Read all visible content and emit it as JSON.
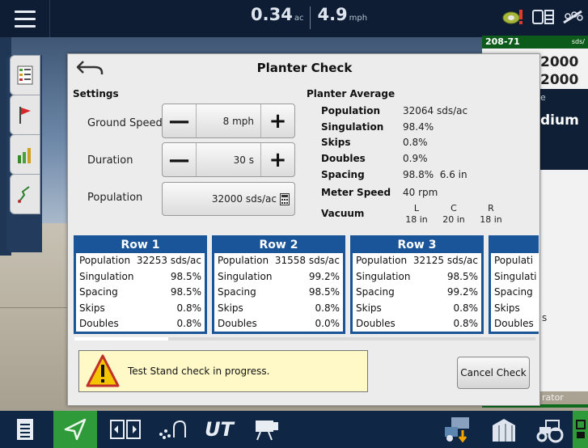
{
  "topbar": {
    "area_value": "0.34",
    "area_unit": "ac",
    "speed_value": "4.9",
    "speed_unit": "mph"
  },
  "right_panel": {
    "header": "208-71",
    "header_small": "sds/",
    "value1": "2000",
    "value2": "2000",
    "label_e": "e",
    "label_dium": "dium",
    "label_s": "s",
    "label_rator": "rator"
  },
  "dialog": {
    "title": "Planter Check",
    "settings": {
      "heading": "Settings",
      "ground_speed_label": "Ground Speed",
      "ground_speed_value": "8 mph",
      "duration_label": "Duration",
      "duration_value": "30 s",
      "population_label": "Population",
      "population_value": "32000 sds/ac"
    },
    "planter_average": {
      "heading": "Planter Average",
      "population_label": "Population",
      "population_value": "32064 sds/ac",
      "singulation_label": "Singulation",
      "singulation_value": "98.4%",
      "skips_label": "Skips",
      "skips_value": "0.8%",
      "doubles_label": "Doubles",
      "doubles_value": "0.9%",
      "spacing_label": "Spacing",
      "spacing_value": "98.8%  6.6 in",
      "meter_speed_label": "Meter Speed",
      "meter_speed_value": "40 rpm",
      "vacuum_label": "Vacuum",
      "vacuum": [
        {
          "side": "L",
          "value": "18 in"
        },
        {
          "side": "C",
          "value": "20 in"
        },
        {
          "side": "R",
          "value": "18 in"
        }
      ]
    },
    "rows": [
      {
        "title": "Row 1",
        "population_label": "Population",
        "population": "32253 sds/ac",
        "singulation_label": "Singulation",
        "singulation": "98.5%",
        "spacing_label": "Spacing",
        "spacing": "98.5%",
        "skips_label": "Skips",
        "skips": "0.8%",
        "doubles_label": "Doubles",
        "doubles": "0.8%"
      },
      {
        "title": "Row 2",
        "population_label": "Population",
        "population": "31558 sds/ac",
        "singulation_label": "Singulation",
        "singulation": "99.2%",
        "spacing_label": "Spacing",
        "spacing": "98.5%",
        "skips_label": "Skips",
        "skips": "0.8%",
        "doubles_label": "Doubles",
        "doubles": "0.0%"
      },
      {
        "title": "Row 3",
        "population_label": "Population",
        "population": "32125 sds/ac",
        "singulation_label": "Singulation",
        "singulation": "98.5%",
        "spacing_label": "Spacing",
        "spacing": "99.2%",
        "skips_label": "Skips",
        "skips": "0.8%",
        "doubles_label": "Doubles",
        "doubles": "0.8%"
      },
      {
        "population_label": "Populati",
        "singulation_label": "Singulati",
        "spacing_label": "Spacing",
        "skips_label": "Skips",
        "doubles_label": "Doubles"
      }
    ],
    "status_text": "Test Stand check in progress.",
    "cancel_label": "Cancel Check"
  },
  "bottombar": {
    "ut_label": "UT"
  },
  "colors": {
    "row_header": "#1a5599",
    "active_nav": "#2f9a3a",
    "status_bg": "#fff9c8"
  }
}
